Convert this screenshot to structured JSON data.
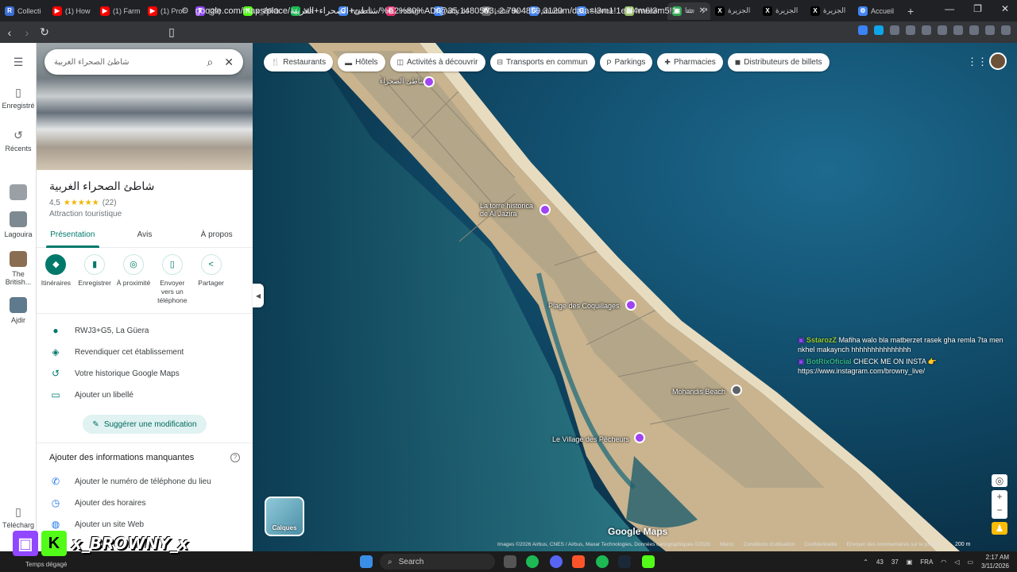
{
  "browser": {
    "tabs": [
      {
        "label": "Collecti",
        "color": "#3b6fd6",
        "glyph": "R"
      },
      {
        "label": "(1) How",
        "color": "#ff0000",
        "glyph": "▶"
      },
      {
        "label": "(1) Farm",
        "color": "#ff0000",
        "glyph": "▶"
      },
      {
        "label": "(1) Prof",
        "color": "#ff0000",
        "glyph": "▶"
      },
      {
        "label": "(29)",
        "color": "#9146ff",
        "glyph": "T"
      },
      {
        "label": "x_BRO",
        "color": "#53fc18",
        "glyph": "K"
      },
      {
        "label": "Ma",
        "color": "#1db954",
        "glyph": "♫"
      },
      {
        "label": "how ol",
        "color": "#4285f4",
        "glyph": "G"
      },
      {
        "label": "Instagr",
        "color": "#e1306c",
        "glyph": "◎"
      },
      {
        "label": "why do",
        "color": "#4285f4",
        "glyph": "G"
      },
      {
        "label": "Liste de",
        "color": "#666666",
        "glyph": "W"
      },
      {
        "label": "source",
        "color": "#4285f4",
        "glyph": "G"
      },
      {
        "label": "Service",
        "color": "#4285f4",
        "glyph": "G"
      },
      {
        "label": "Wester",
        "color": "#9bbf6b",
        "glyph": "▤"
      },
      {
        "label": "شا",
        "color": "#34a853",
        "glyph": "◉",
        "active": true
      },
      {
        "label": "الجزيرة",
        "color": "#000000",
        "glyph": "X"
      },
      {
        "label": "الجزيرة",
        "color": "#000000",
        "glyph": "X"
      },
      {
        "label": "الجزيرة",
        "color": "#000000",
        "glyph": "X"
      },
      {
        "label": "Accueil",
        "color": "#4285f4",
        "glyph": "⚙"
      }
    ],
    "url": "google.com/maps/place/شاطئ+الصحراء+الغربية/%E2%80%AD/@35.1480553,-2.7904859,3120m/data=!3m1!1e3!4m6!3m5!1s0xea1b1004927251..."
  },
  "rail": {
    "saved": "Enregistré",
    "recents": "Récents",
    "recent_places": [
      "Lagouira",
      "The British...",
      "Ajdir"
    ],
    "download": "Télécharg"
  },
  "panel": {
    "search_value": "شاطئ الصحراء الغربية",
    "title": "شاطئ الصحراء الغربية",
    "rating": "4,5",
    "stars": "★★★★★",
    "reviews": "(22)",
    "type": "Attraction touristique",
    "tabs": [
      "Présentation",
      "Avis",
      "À propos"
    ],
    "actions": [
      {
        "label": "Itinéraires",
        "icon": "◆"
      },
      {
        "label": "Enregistrer",
        "icon": "▮"
      },
      {
        "label": "À proximité",
        "icon": "◎"
      },
      {
        "label": "Envoyer vers un téléphone",
        "icon": "▯"
      },
      {
        "label": "Partager",
        "icon": "<"
      }
    ],
    "info": [
      {
        "text": "RWJ3+G5, La Güera",
        "icon": "●"
      },
      {
        "text": "Revendiquer cet établissement",
        "icon": "◈"
      },
      {
        "text": "Votre historique Google Maps",
        "icon": "↺"
      },
      {
        "text": "Ajouter un libellé",
        "icon": "▭"
      }
    ],
    "suggest": "Suggérer une modification",
    "missing_title": "Ajouter des informations manquantes",
    "missing": [
      {
        "text": "Ajouter le numéro de téléphone du lieu",
        "icon": "✆"
      },
      {
        "text": "Ajouter des horaires",
        "icon": "◷"
      },
      {
        "text": "Ajouter un site Web",
        "icon": "◍"
      }
    ]
  },
  "map": {
    "chips": [
      {
        "label": "Restaurants",
        "icon": "🍴"
      },
      {
        "label": "Hôtels",
        "icon": "▬"
      },
      {
        "label": "Activités à découvrir",
        "icon": "◫"
      },
      {
        "label": "Transports en commun",
        "icon": "⊟"
      },
      {
        "label": "Parkings",
        "icon": "P"
      },
      {
        "label": "Pharmacies",
        "icon": "✚"
      },
      {
        "label": "Distributeurs de billets",
        "icon": "◼"
      }
    ],
    "poi": {
      "top": "شاطئ الصحراء",
      "torre": "La torre historica de Al Jazira",
      "plage": "Plage des Coquillages",
      "mohandis": "Mohandis Beach",
      "village": "Le Village des Pêcheurs"
    },
    "layers": "Calques",
    "brand": "Google Maps",
    "attribution": [
      "Images ©2026 Airbus, CNES / Airbus, Maxar Technologies, Données cartographiques ©2026",
      "Maroc",
      "Conditions d'utilisation",
      "Confidentialité",
      "Envoyer des commentaires sur le produit"
    ],
    "scale": "200 m"
  },
  "chat": [
    {
      "user": "SstarozZ",
      "color": "#9acd32",
      "msg": "Mafiha walo bla matberzet rasek gha remla 7ta men nkhel makaynch hhhhhhhhhhhhhhh"
    },
    {
      "user": "BotRixOficial",
      "color": "#33b58a",
      "msg": "CHECK ME ON INSTA 👉 https://www.instagram.com/browny_live/"
    }
  ],
  "overlay": {
    "streamer": "x_BROWNY_x",
    "weather": "Temps dégagé"
  },
  "taskbar": {
    "search": "Search",
    "tray_a": "43",
    "tray_b": "37",
    "lang": "FRA",
    "time": "2:17 AM",
    "date": "3/11/2026"
  }
}
